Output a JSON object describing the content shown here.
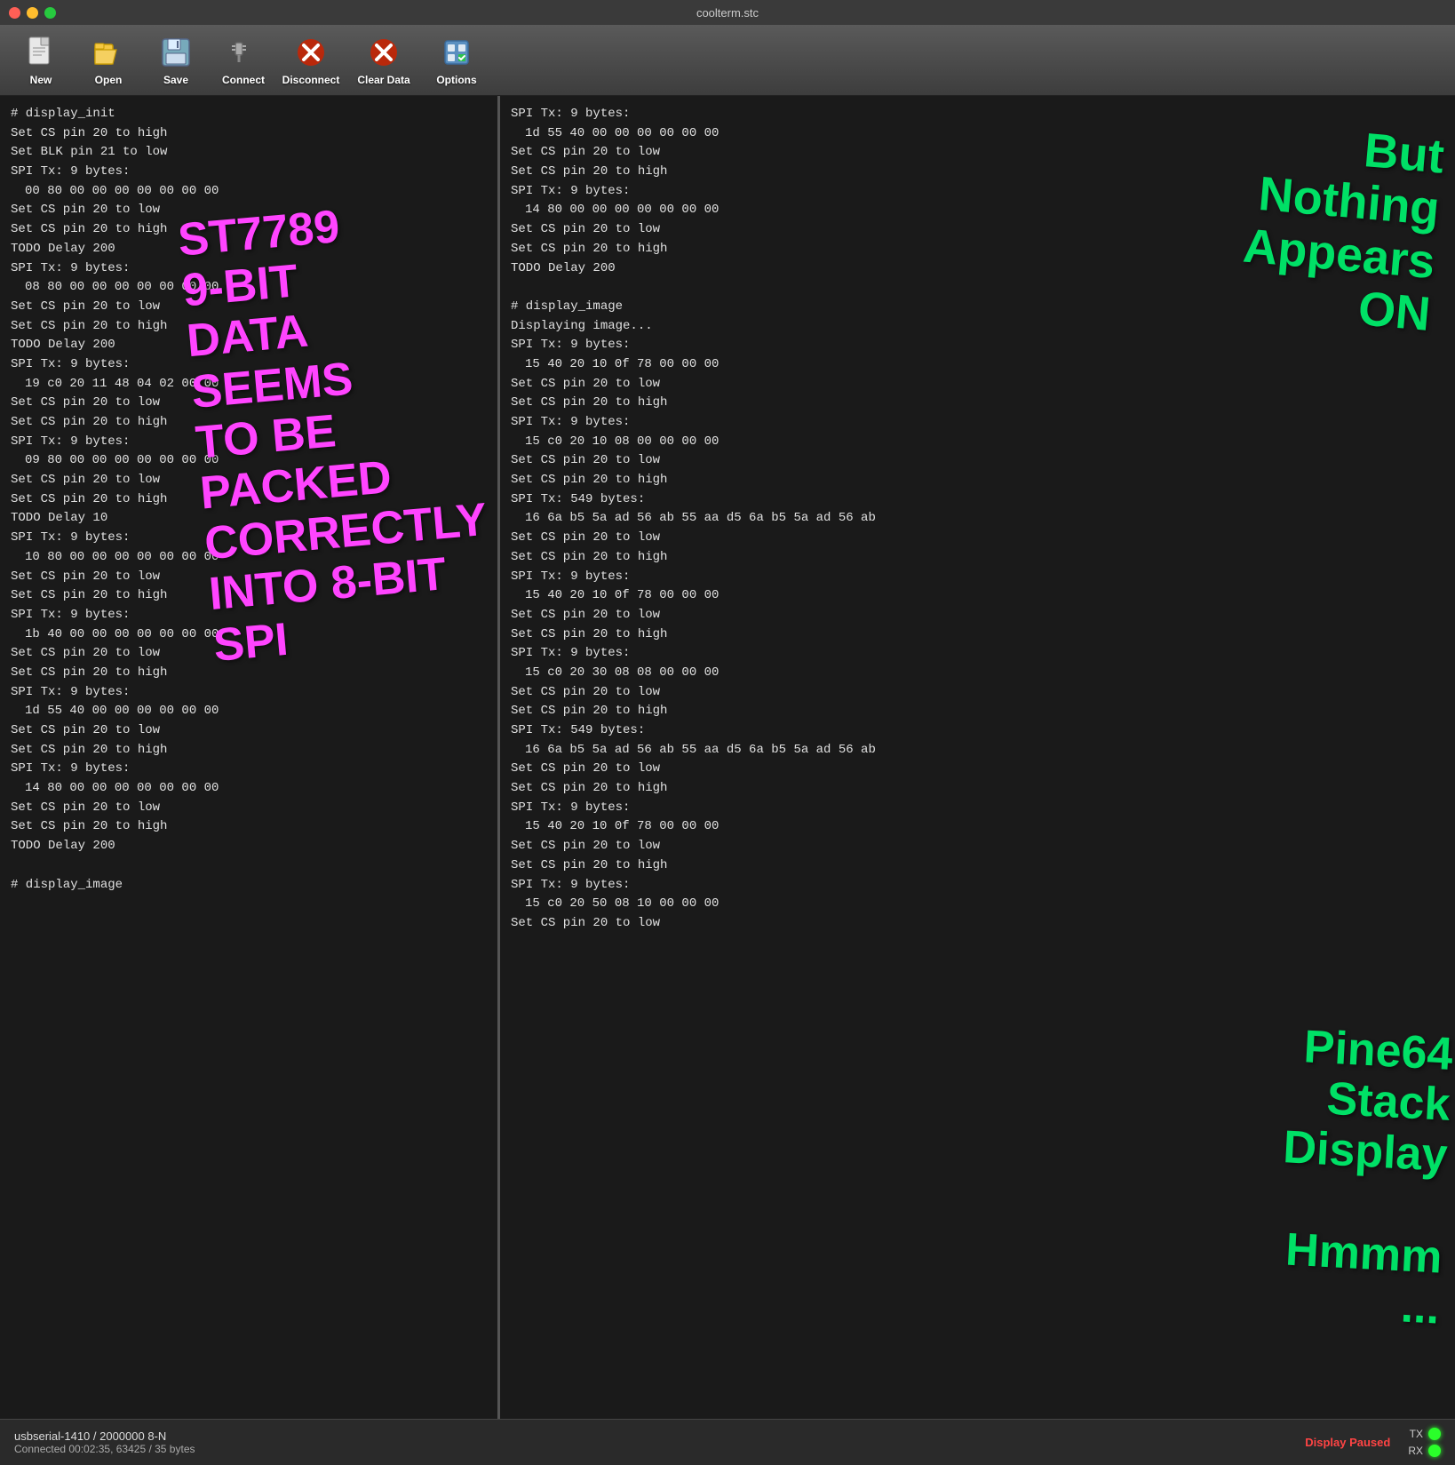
{
  "titlebar": {
    "title": "coolterm.stc"
  },
  "toolbar": {
    "buttons": [
      {
        "id": "new",
        "label": "New"
      },
      {
        "id": "open",
        "label": "Open"
      },
      {
        "id": "save",
        "label": "Save"
      },
      {
        "id": "connect",
        "label": "Connect"
      },
      {
        "id": "disconnect",
        "label": "Disconnect"
      },
      {
        "id": "clear-data",
        "label": "Clear Data"
      },
      {
        "id": "options",
        "label": "Options"
      }
    ]
  },
  "left_terminal": {
    "lines": [
      "# display_init",
      "Set CS pin 20 to high",
      "Set BLK pin 21 to low",
      "SPI Tx: 9 bytes:",
      " 00 80 00 00 00 00 00 00 00",
      "Set CS pin 20 to low",
      "Set CS pin 20 to high",
      "TODO Delay 200",
      "SPI Tx: 9 bytes:",
      " 08 80 00 00 00 00 00 00 00",
      "Set CS pin 20 to low",
      "Set CS pin 20 to high",
      "TODO Delay 200",
      "SPI Tx: 9 bytes:",
      " 19 c0 20 11 48 04 02 00 00",
      "Set CS pin 20 to low",
      "Set CS pin 20 to high",
      "SPI Tx: 9 bytes:",
      " 09 80 00 00 00 00 00 00 00",
      "Set CS pin 20 to low",
      "Set CS pin 20 to high",
      "TODO Delay 10",
      "SPI Tx: 9 bytes:",
      " 10 80 00 00 00 00 00 00 00",
      "Set CS pin 20 to low",
      "Set CS pin 20 to high",
      "SPI Tx: 9 bytes:",
      " 1b 40 00 00 00 00 00 00 00",
      "Set CS pin 20 to low",
      "Set CS pin 20 to high",
      "SPI Tx: 9 bytes:",
      " 1d 55 40 00 00 00 00 00 00",
      "Set CS pin 20 to low",
      "Set CS pin 20 to high",
      "SPI Tx: 9 bytes:",
      " 14 80 00 00 00 00 00 00 00",
      "Set CS pin 20 to low",
      "Set CS pin 20 to high",
      "TODO Delay 200",
      "",
      "# display_image"
    ]
  },
  "annotation_left": {
    "text": "ST7789\n9-BIT\nDATA\nSEEMS\nTO BE\nPACKED\nCORRECTLY\nINTO 8-BIT\nSPI"
  },
  "right_terminal": {
    "lines": [
      "SPI Tx: 9 bytes:",
      " 1d 55 40 00 00 00 00 00 00",
      "Set CS pin 20 to low",
      "Set CS pin 20 to high",
      "SPI Tx: 9 bytes:",
      " 14 80 00 00 00 00 00 00 00",
      "Set CS pin 20 to low",
      "Set CS pin 20 to high",
      "TODO Delay 200",
      "",
      "# display_image",
      "Displaying image...",
      "SPI Tx: 9 bytes:",
      " 15 40 20 10 0f 78 00 00 00",
      "Set CS pin 20 to low",
      "Set CS pin 20 to high",
      "SPI Tx: 9 bytes:",
      " 15 c0 20 10 08 00 00 00 00",
      "Set CS pin 20 to low",
      "Set CS pin 20 to high",
      "SPI Tx: 549 bytes:",
      " 16 6a b5 5a ad 56 ab 55 aa d5 6a b5 5a ad 56 ab",
      "Set CS pin 20 to low",
      "Set CS pin 20 to high",
      "SPI Tx: 9 bytes:",
      " 15 40 20 10 0f 78 00 00 00",
      "Set CS pin 20 to low",
      "Set CS pin 20 to high",
      "SPI Tx: 9 bytes:",
      " 15 c0 20 30 08 08 00 00 00",
      "Set CS pin 20 to low",
      "Set CS pin 20 to high",
      "SPI Tx: 549 bytes:",
      " 16 6a b5 5a ad 56 ab 55 aa d5 6a b5 5a ad 56 ab",
      "Set CS pin 20 to low",
      "Set CS pin 20 to high",
      "SPI Tx: 9 bytes:",
      " 15 40 20 10 0f 78 00 00 00",
      "Set CS pin 20 to low",
      "Set CS pin 20 to high",
      "SPI Tx: 9 bytes:",
      " 15 c0 20 50 08 10 00 00 00",
      "Set CS pin 20 to low"
    ]
  },
  "annotation_right_top": {
    "text": "But\nNothing\nAppears\nON"
  },
  "annotation_right_bottom": {
    "text": "Pine64\nStack\nDisplay\n\nHmmm\n..."
  },
  "statusbar": {
    "connection": "usbserial-1410 / 2000000 8-N",
    "connected_info": "Connected 00:02:35, 63425 / 35 bytes",
    "display_paused": "Display Paused",
    "leds": [
      {
        "label": "TX"
      },
      {
        "label": "RX"
      }
    ]
  }
}
